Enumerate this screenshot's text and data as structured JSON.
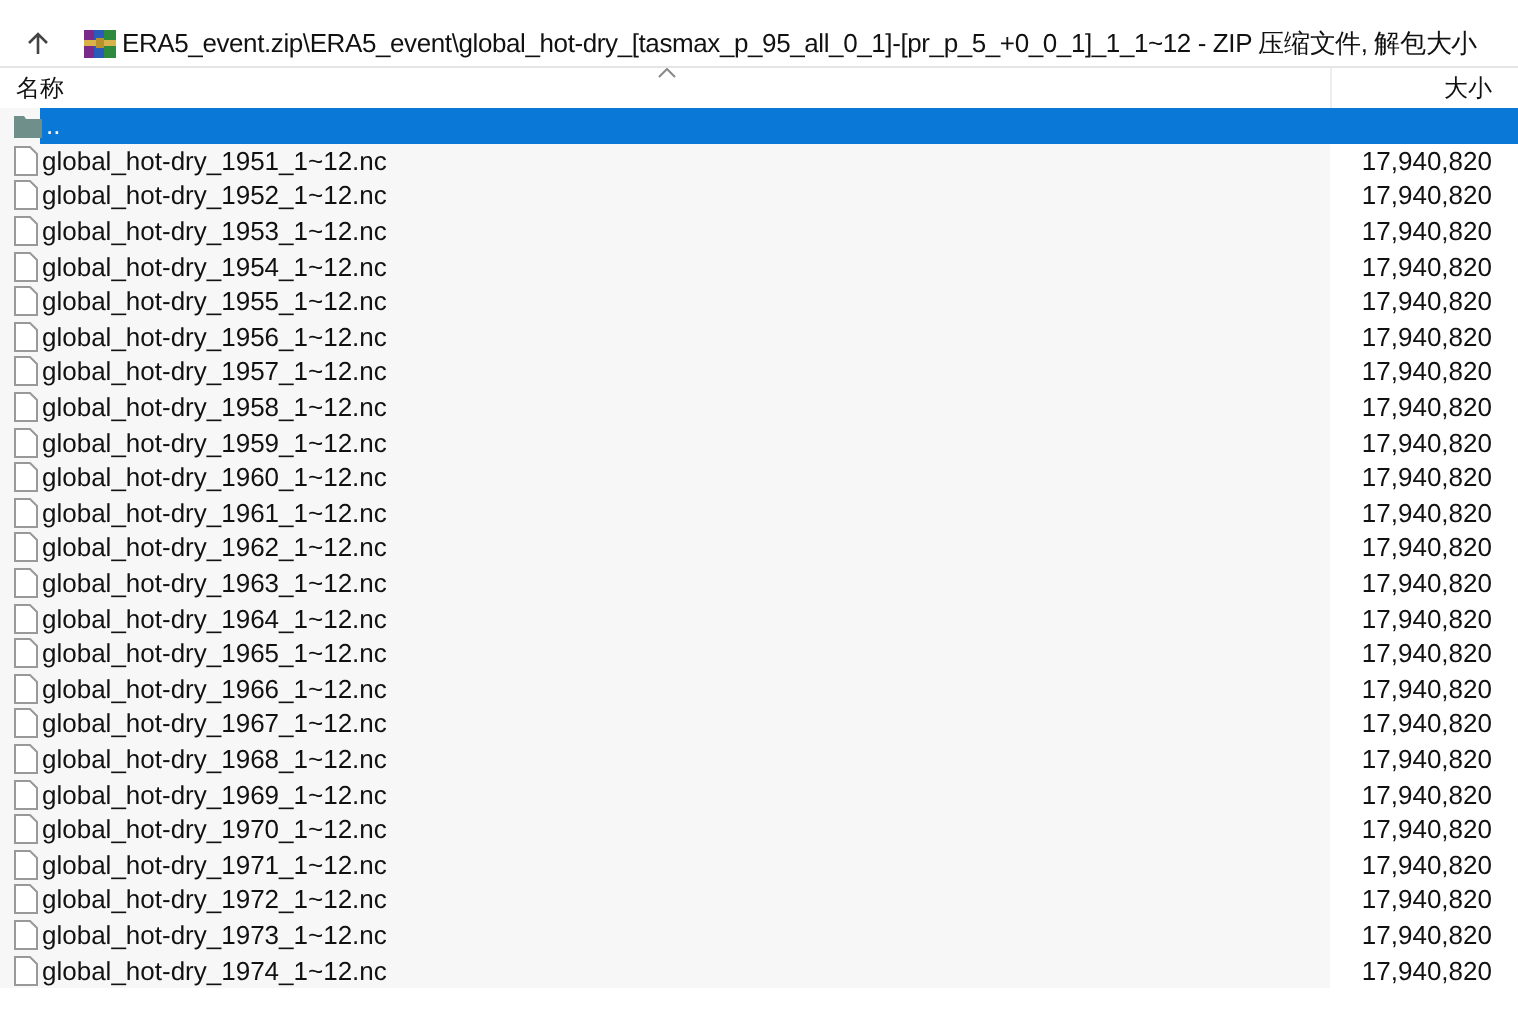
{
  "address_bar": {
    "path": "ERA5_event.zip\\ERA5_event\\global_hot-dry_[tasmax_p_95_all_0_1]-[pr_p_5_+0_0_1]_1_1~12 - ZIP 压缩文件, 解包大小"
  },
  "columns": [
    {
      "label": "名称"
    },
    {
      "label": "大小"
    }
  ],
  "rows": [
    {
      "kind": "folder",
      "name": "..",
      "size": "",
      "selected": true
    },
    {
      "kind": "file",
      "name": "global_hot-dry_1951_1~12.nc",
      "size": "17,940,820",
      "selected": false
    },
    {
      "kind": "file",
      "name": "global_hot-dry_1952_1~12.nc",
      "size": "17,940,820",
      "selected": false
    },
    {
      "kind": "file",
      "name": "global_hot-dry_1953_1~12.nc",
      "size": "17,940,820",
      "selected": false
    },
    {
      "kind": "file",
      "name": "global_hot-dry_1954_1~12.nc",
      "size": "17,940,820",
      "selected": false
    },
    {
      "kind": "file",
      "name": "global_hot-dry_1955_1~12.nc",
      "size": "17,940,820",
      "selected": false
    },
    {
      "kind": "file",
      "name": "global_hot-dry_1956_1~12.nc",
      "size": "17,940,820",
      "selected": false
    },
    {
      "kind": "file",
      "name": "global_hot-dry_1957_1~12.nc",
      "size": "17,940,820",
      "selected": false
    },
    {
      "kind": "file",
      "name": "global_hot-dry_1958_1~12.nc",
      "size": "17,940,820",
      "selected": false
    },
    {
      "kind": "file",
      "name": "global_hot-dry_1959_1~12.nc",
      "size": "17,940,820",
      "selected": false
    },
    {
      "kind": "file",
      "name": "global_hot-dry_1960_1~12.nc",
      "size": "17,940,820",
      "selected": false
    },
    {
      "kind": "file",
      "name": "global_hot-dry_1961_1~12.nc",
      "size": "17,940,820",
      "selected": false
    },
    {
      "kind": "file",
      "name": "global_hot-dry_1962_1~12.nc",
      "size": "17,940,820",
      "selected": false
    },
    {
      "kind": "file",
      "name": "global_hot-dry_1963_1~12.nc",
      "size": "17,940,820",
      "selected": false
    },
    {
      "kind": "file",
      "name": "global_hot-dry_1964_1~12.nc",
      "size": "17,940,820",
      "selected": false
    },
    {
      "kind": "file",
      "name": "global_hot-dry_1965_1~12.nc",
      "size": "17,940,820",
      "selected": false
    },
    {
      "kind": "file",
      "name": "global_hot-dry_1966_1~12.nc",
      "size": "17,940,820",
      "selected": false
    },
    {
      "kind": "file",
      "name": "global_hot-dry_1967_1~12.nc",
      "size": "17,940,820",
      "selected": false
    },
    {
      "kind": "file",
      "name": "global_hot-dry_1968_1~12.nc",
      "size": "17,940,820",
      "selected": false
    },
    {
      "kind": "file",
      "name": "global_hot-dry_1969_1~12.nc",
      "size": "17,940,820",
      "selected": false
    },
    {
      "kind": "file",
      "name": "global_hot-dry_1970_1~12.nc",
      "size": "17,940,820",
      "selected": false
    },
    {
      "kind": "file",
      "name": "global_hot-dry_1971_1~12.nc",
      "size": "17,940,820",
      "selected": false
    },
    {
      "kind": "file",
      "name": "global_hot-dry_1972_1~12.nc",
      "size": "17,940,820",
      "selected": false
    },
    {
      "kind": "file",
      "name": "global_hot-dry_1973_1~12.nc",
      "size": "17,940,820",
      "selected": false
    },
    {
      "kind": "file",
      "name": "global_hot-dry_1974_1~12.nc",
      "size": "17,940,820",
      "selected": false
    }
  ]
}
